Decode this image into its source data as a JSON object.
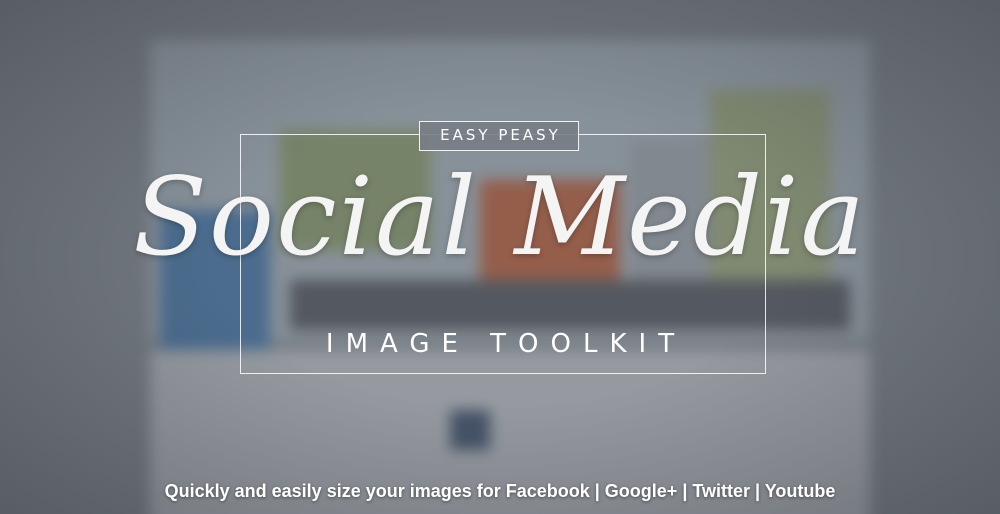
{
  "banner": {
    "kicker": "EASY PEASY",
    "title": "Social Media",
    "subtitle": "IMAGE TOOLKIT",
    "tagline": "Quickly and easily size your images for Facebook | Google+ | Twitter | Youtube"
  },
  "colors": {
    "text": "#ffffff",
    "overlay": "#7a7f86",
    "accent_orange": "#d9592b",
    "accent_green": "#8fa95d",
    "accent_blue": "#3f7fc1"
  }
}
